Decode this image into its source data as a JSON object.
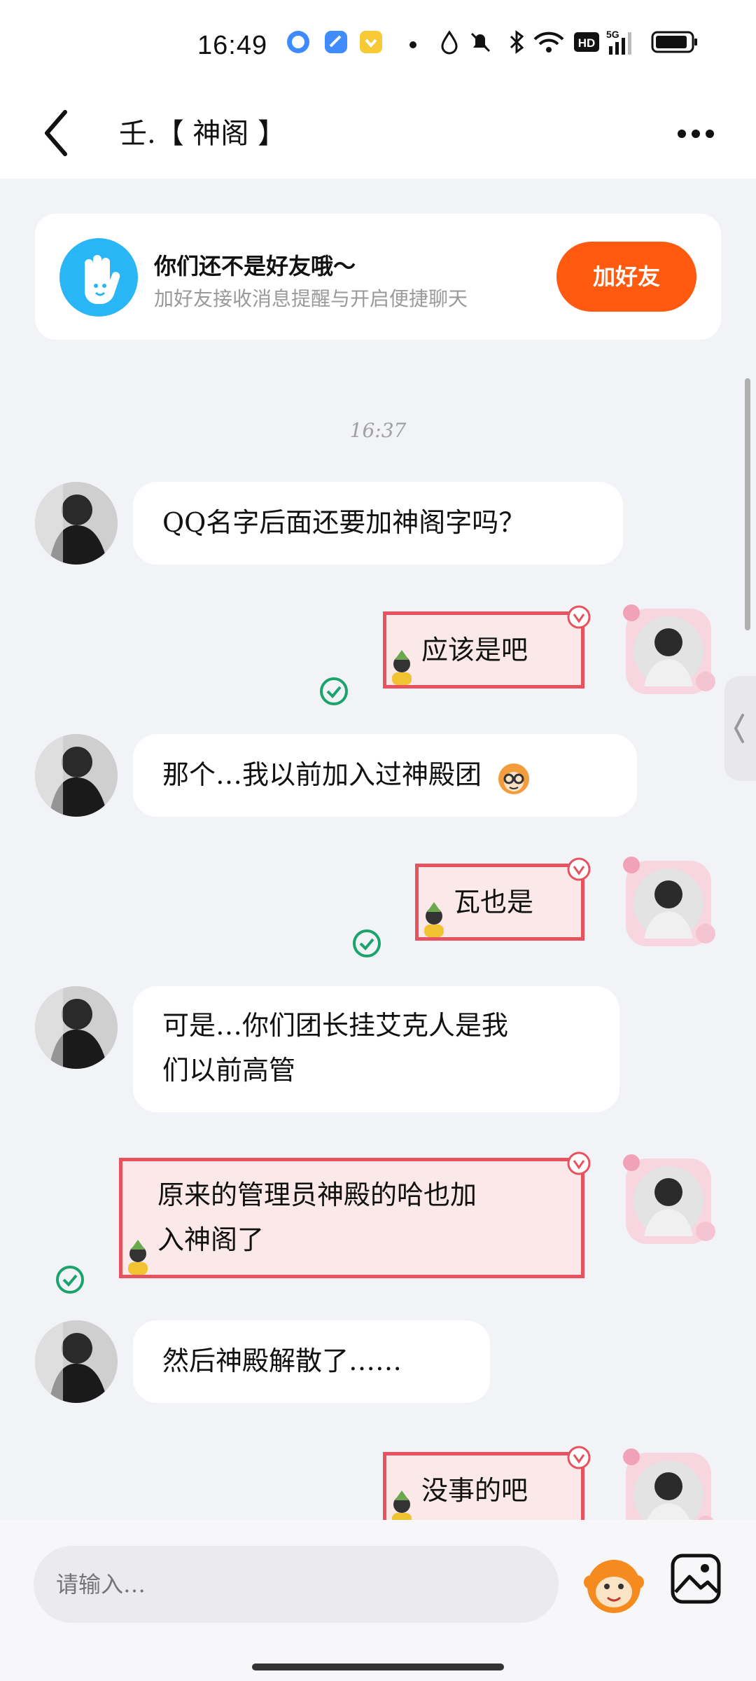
{
  "status_bar": {
    "time": "16:49",
    "icons": [
      "qq-icon",
      "blue-app-icon",
      "yellow-app-icon",
      "dot-icon",
      "drop-icon",
      "mute-bell-icon",
      "bluetooth-icon",
      "wifi-icon",
      "hd-icon",
      "5g-signal-icon",
      "battery-icon"
    ]
  },
  "header": {
    "title": "壬.【 神阁 】"
  },
  "friend_card": {
    "title": "你们还不是好友哦～",
    "subtitle": "加好友接收消息提醒与开启便捷聊天",
    "button_label": "加好友",
    "accent": "#ff5a0f"
  },
  "timestamp": "16:37",
  "messages": [
    {
      "side": "left",
      "lines": [
        "QQ名字后面还要加神阁字吗？"
      ]
    },
    {
      "side": "right",
      "lines": [
        "应该是吧"
      ]
    },
    {
      "side": "left",
      "lines": [
        "那个…我以前加入过神殿团"
      ],
      "emoji": "monkey-glasses-emoji"
    },
    {
      "side": "right",
      "lines": [
        "瓦也是"
      ]
    },
    {
      "side": "left",
      "lines": [
        "可是…你们团长挂艾克人是我",
        "们以前高管"
      ]
    },
    {
      "side": "right",
      "lines": [
        "原来的管理员神殿的哈也加",
        "入神阁了"
      ]
    },
    {
      "side": "left",
      "lines": [
        "然后神殿解散了……"
      ]
    },
    {
      "side": "right",
      "lines": [
        "没事的吧"
      ]
    }
  ],
  "input": {
    "placeholder": "请输入…"
  },
  "colors": {
    "bubble_right_border": "#e8525e",
    "bubble_right_fill": "#fbe8e8",
    "check_green": "#1aa36c"
  }
}
